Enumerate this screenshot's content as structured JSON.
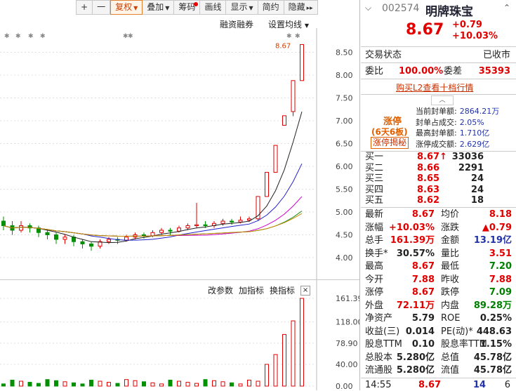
{
  "toolbar": {
    "plus": "+",
    "minus": "一",
    "fuquan": "复权",
    "diejia": "叠加",
    "chouma": "筹码",
    "huaxian": "画线",
    "xianshi": "显示",
    "jianyue": "简约",
    "yincang": "隐藏",
    "more": "▸▸"
  },
  "chart_header": {
    "margin": "融资融券",
    "ma_settings": "设置均线"
  },
  "price_axis": [
    "8.50",
    "8.00",
    "7.50",
    "7.00",
    "6.50",
    "6.00",
    "5.50",
    "5.00",
    "4.50",
    "4.00"
  ],
  "last_price_tag": "8.67",
  "indicator_bar": {
    "modify": "改参数",
    "add": "加指标",
    "switch": "换指标",
    "close": "×"
  },
  "volume_axis": [
    "161.39",
    "118.00",
    "78.90",
    "40.00",
    "0.00"
  ],
  "stock": {
    "code": "002574",
    "name": "明牌珠宝",
    "price": "8.67",
    "change": "+0.79",
    "pct": "+10.03%"
  },
  "status": {
    "label": "交易状态",
    "value": "已收市"
  },
  "weibi": {
    "label1": "委比",
    "v1": "100.00%",
    "label2": "委差",
    "v2": "35393"
  },
  "l2_link": "购买L2查看十档行情",
  "limit_up": {
    "title": "涨停",
    "sub": "(6天6板)",
    "button": "涨停揭秘",
    "items": [
      {
        "label": "当前封单额:",
        "value": "2864.21万"
      },
      {
        "label": "封单占成交:",
        "value": "2.05%"
      },
      {
        "label": "最高封单额:",
        "value": "1.710亿"
      },
      {
        "label": "涨停成交额:",
        "value": "2.629亿"
      }
    ]
  },
  "bids": [
    {
      "label": "买一",
      "price": "8.67↑",
      "vol": "33036"
    },
    {
      "label": "买二",
      "price": "8.66",
      "vol": "2291"
    },
    {
      "label": "买三",
      "price": "8.65",
      "vol": "24"
    },
    {
      "label": "买四",
      "price": "8.63",
      "vol": "24"
    },
    {
      "label": "买五",
      "price": "8.62",
      "vol": "18"
    }
  ],
  "quote": [
    {
      "l1": "最新",
      "v1": "8.67",
      "l2": "均价",
      "v2": "8.18"
    },
    {
      "l1": "涨幅",
      "v1": "+10.03%",
      "l2": "涨跌",
      "v2": "▲0.79"
    },
    {
      "l1": "总手",
      "v1": "161.39万",
      "l2": "金额",
      "v2": "13.19亿"
    },
    {
      "l1": "换手*",
      "v1": "30.57%",
      "l2": "量比",
      "v2": "3.51"
    },
    {
      "l1": "最高",
      "v1": "8.67",
      "l2": "最低",
      "v2": "7.20"
    },
    {
      "l1": "今开",
      "v1": "7.88",
      "l2": "昨收",
      "v2": "7.88"
    },
    {
      "l1": "涨停",
      "v1": "8.67",
      "l2": "跌停",
      "v2": "7.09"
    },
    {
      "l1": "外盘",
      "v1": "72.11万",
      "l2": "内盘",
      "v2": "89.28万"
    },
    {
      "l1": "净资产",
      "v1": "5.79",
      "l2": "ROE",
      "v2": "0.25%"
    },
    {
      "l1": "收益(三)",
      "v1": "0.014",
      "l2": "PE(动)*",
      "v2": "448.63"
    },
    {
      "l1": "股息TTM",
      "v1": "0.10",
      "l2": "股息率TTM",
      "v2": "1.15%"
    },
    {
      "l1": "总股本",
      "v1": "5.280亿",
      "l2": "总值",
      "v2": "45.78亿"
    },
    {
      "l1": "流通股",
      "v1": "5.280亿",
      "l2": "流值",
      "v2": "45.78亿"
    }
  ],
  "tick": {
    "time": "14:55",
    "price": "8.67",
    "vol": "14",
    "num": "6"
  },
  "chart_data": {
    "type": "candlestick",
    "candles": [
      {
        "o": 4.8,
        "c": 4.7,
        "h": 4.9,
        "l": 4.6
      },
      {
        "o": 4.7,
        "c": 4.6,
        "h": 4.8,
        "l": 4.5
      },
      {
        "o": 4.6,
        "c": 4.7,
        "h": 4.8,
        "l": 4.55
      },
      {
        "o": 4.7,
        "c": 4.65,
        "h": 4.75,
        "l": 4.55
      },
      {
        "o": 4.65,
        "c": 4.55,
        "h": 4.7,
        "l": 4.45
      },
      {
        "o": 4.55,
        "c": 4.5,
        "h": 4.6,
        "l": 4.4
      },
      {
        "o": 4.5,
        "c": 4.4,
        "h": 4.55,
        "l": 4.3
      },
      {
        "o": 4.4,
        "c": 4.45,
        "h": 4.5,
        "l": 4.3
      },
      {
        "o": 4.45,
        "c": 4.35,
        "h": 4.5,
        "l": 4.25
      },
      {
        "o": 4.35,
        "c": 4.3,
        "h": 4.4,
        "l": 4.2
      },
      {
        "o": 4.3,
        "c": 4.25,
        "h": 4.35,
        "l": 4.15
      },
      {
        "o": 4.25,
        "c": 4.35,
        "h": 4.4,
        "l": 4.2
      },
      {
        "o": 4.35,
        "c": 4.4,
        "h": 4.45,
        "l": 4.3
      },
      {
        "o": 4.4,
        "c": 4.38,
        "h": 4.45,
        "l": 4.3
      },
      {
        "o": 4.38,
        "c": 4.45,
        "h": 4.5,
        "l": 4.35
      },
      {
        "o": 4.45,
        "c": 4.5,
        "h": 4.55,
        "l": 4.4
      },
      {
        "o": 4.5,
        "c": 4.48,
        "h": 4.55,
        "l": 4.42
      },
      {
        "o": 4.48,
        "c": 4.55,
        "h": 4.6,
        "l": 4.45
      },
      {
        "o": 4.55,
        "c": 4.6,
        "h": 4.65,
        "l": 4.5
      },
      {
        "o": 4.6,
        "c": 4.58,
        "h": 4.65,
        "l": 4.5
      },
      {
        "o": 4.58,
        "c": 4.65,
        "h": 4.7,
        "l": 4.55
      },
      {
        "o": 4.65,
        "c": 4.7,
        "h": 4.75,
        "l": 4.6
      },
      {
        "o": 4.7,
        "c": 4.72,
        "h": 5.2,
        "l": 4.65
      },
      {
        "o": 4.72,
        "c": 4.7,
        "h": 4.8,
        "l": 4.65
      },
      {
        "o": 4.7,
        "c": 4.75,
        "h": 4.8,
        "l": 4.65
      },
      {
        "o": 4.75,
        "c": 4.8,
        "h": 4.85,
        "l": 4.7
      },
      {
        "o": 4.8,
        "c": 4.78,
        "h": 4.85,
        "l": 4.72
      },
      {
        "o": 4.78,
        "c": 4.82,
        "h": 4.9,
        "l": 4.75
      },
      {
        "o": 4.82,
        "c": 4.85,
        "h": 4.9,
        "l": 4.78
      },
      {
        "o": 4.85,
        "c": 5.34,
        "h": 5.34,
        "l": 4.82
      },
      {
        "o": 5.34,
        "c": 5.87,
        "h": 5.87,
        "l": 5.34
      },
      {
        "o": 5.87,
        "c": 6.46,
        "h": 6.46,
        "l": 5.87
      },
      {
        "o": 6.9,
        "c": 7.11,
        "h": 7.11,
        "l": 6.9
      },
      {
        "o": 7.2,
        "c": 7.88,
        "h": 7.88,
        "l": 7.1
      },
      {
        "o": 7.88,
        "c": 8.67,
        "h": 8.67,
        "l": 7.88
      }
    ],
    "ylim": [
      3.8,
      8.8
    ],
    "volume_ylim": [
      0,
      161.39
    ]
  }
}
